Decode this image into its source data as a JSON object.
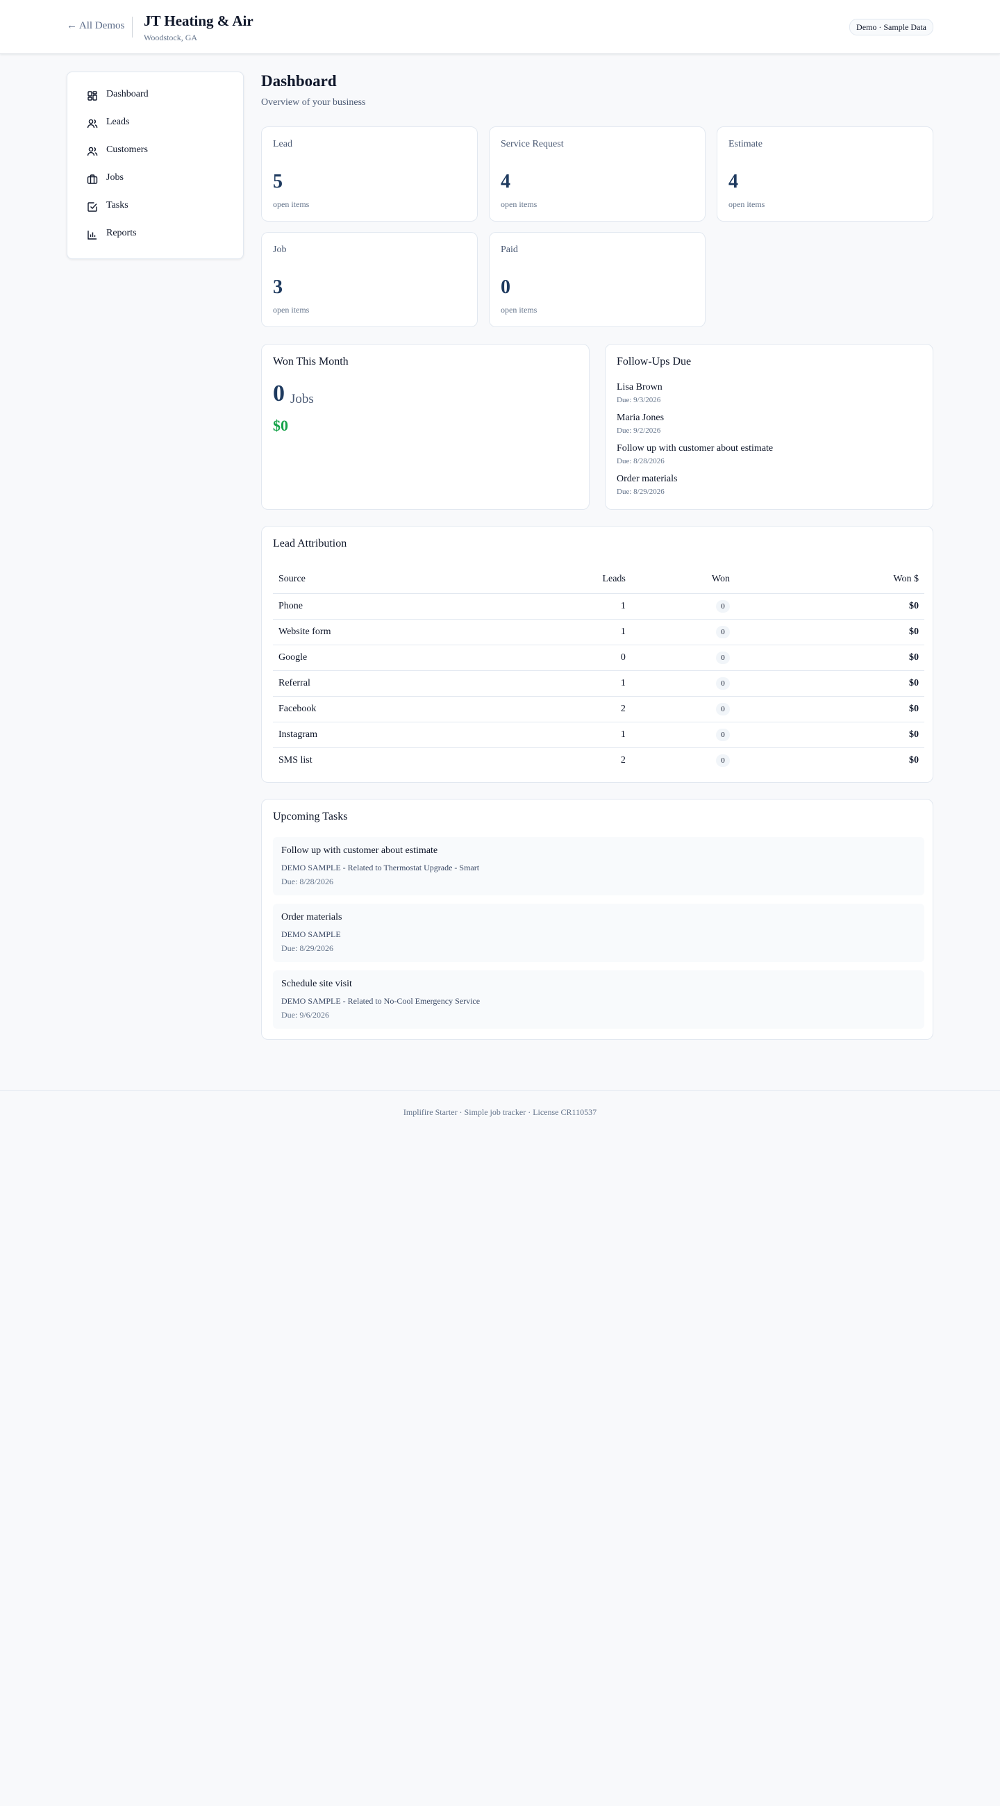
{
  "header": {
    "back_link": "← All Demos",
    "company_name": "JT Heating & Air",
    "company_location": "Woodstock, GA",
    "demo_badge": "Demo · Sample Data"
  },
  "sidebar": {
    "items": [
      {
        "label": "Dashboard",
        "icon": "dashboard-icon"
      },
      {
        "label": "Leads",
        "icon": "users-icon"
      },
      {
        "label": "Customers",
        "icon": "users-icon"
      },
      {
        "label": "Jobs",
        "icon": "briefcase-icon"
      },
      {
        "label": "Tasks",
        "icon": "check-square-icon"
      },
      {
        "label": "Reports",
        "icon": "bar-chart-icon"
      }
    ]
  },
  "main": {
    "title": "Dashboard",
    "subtitle": "Overview of your business",
    "stats": [
      {
        "title": "Lead",
        "value": "5",
        "sub": "open items"
      },
      {
        "title": "Service Request",
        "value": "4",
        "sub": "open items"
      },
      {
        "title": "Estimate",
        "value": "4",
        "sub": "open items"
      },
      {
        "title": "Job",
        "value": "3",
        "sub": "open items"
      },
      {
        "title": "Paid",
        "value": "0",
        "sub": "open items"
      }
    ],
    "won": {
      "title": "Won This Month",
      "count": "0",
      "unit": "Jobs",
      "amount": "$0"
    },
    "followups": {
      "title": "Follow-Ups Due",
      "items": [
        {
          "name": "Lisa Brown",
          "due": "Due: 9/3/2026"
        },
        {
          "name": "Maria Jones",
          "due": "Due: 9/2/2026"
        },
        {
          "name": "Follow up with customer about estimate",
          "due": "Due: 8/28/2026"
        },
        {
          "name": "Order materials",
          "due": "Due: 8/29/2026"
        }
      ]
    },
    "attribution": {
      "title": "Lead Attribution",
      "columns": [
        "Source",
        "Leads",
        "Won",
        "Won $"
      ],
      "rows": [
        {
          "source": "Phone",
          "leads": "1",
          "won": "0",
          "won_amount": "$0"
        },
        {
          "source": "Website form",
          "leads": "1",
          "won": "0",
          "won_amount": "$0"
        },
        {
          "source": "Google",
          "leads": "0",
          "won": "0",
          "won_amount": "$0"
        },
        {
          "source": "Referral",
          "leads": "1",
          "won": "0",
          "won_amount": "$0"
        },
        {
          "source": "Facebook",
          "leads": "2",
          "won": "0",
          "won_amount": "$0"
        },
        {
          "source": "Instagram",
          "leads": "1",
          "won": "0",
          "won_amount": "$0"
        },
        {
          "source": "SMS list",
          "leads": "2",
          "won": "0",
          "won_amount": "$0"
        }
      ]
    },
    "tasks": {
      "title": "Upcoming Tasks",
      "items": [
        {
          "title": "Follow up with customer about estimate",
          "detail": "DEMO SAMPLE - Related to Thermostat Upgrade - Smart",
          "due": "Due: 8/28/2026"
        },
        {
          "title": "Order materials",
          "detail": "DEMO SAMPLE",
          "due": "Due: 8/29/2026"
        },
        {
          "title": "Schedule site visit",
          "detail": "DEMO SAMPLE - Related to No-Cool Emergency Service",
          "due": "Due: 9/6/2026"
        }
      ]
    }
  },
  "footer": {
    "text": "Implifire Starter · Simple job tracker · License CR110537"
  }
}
